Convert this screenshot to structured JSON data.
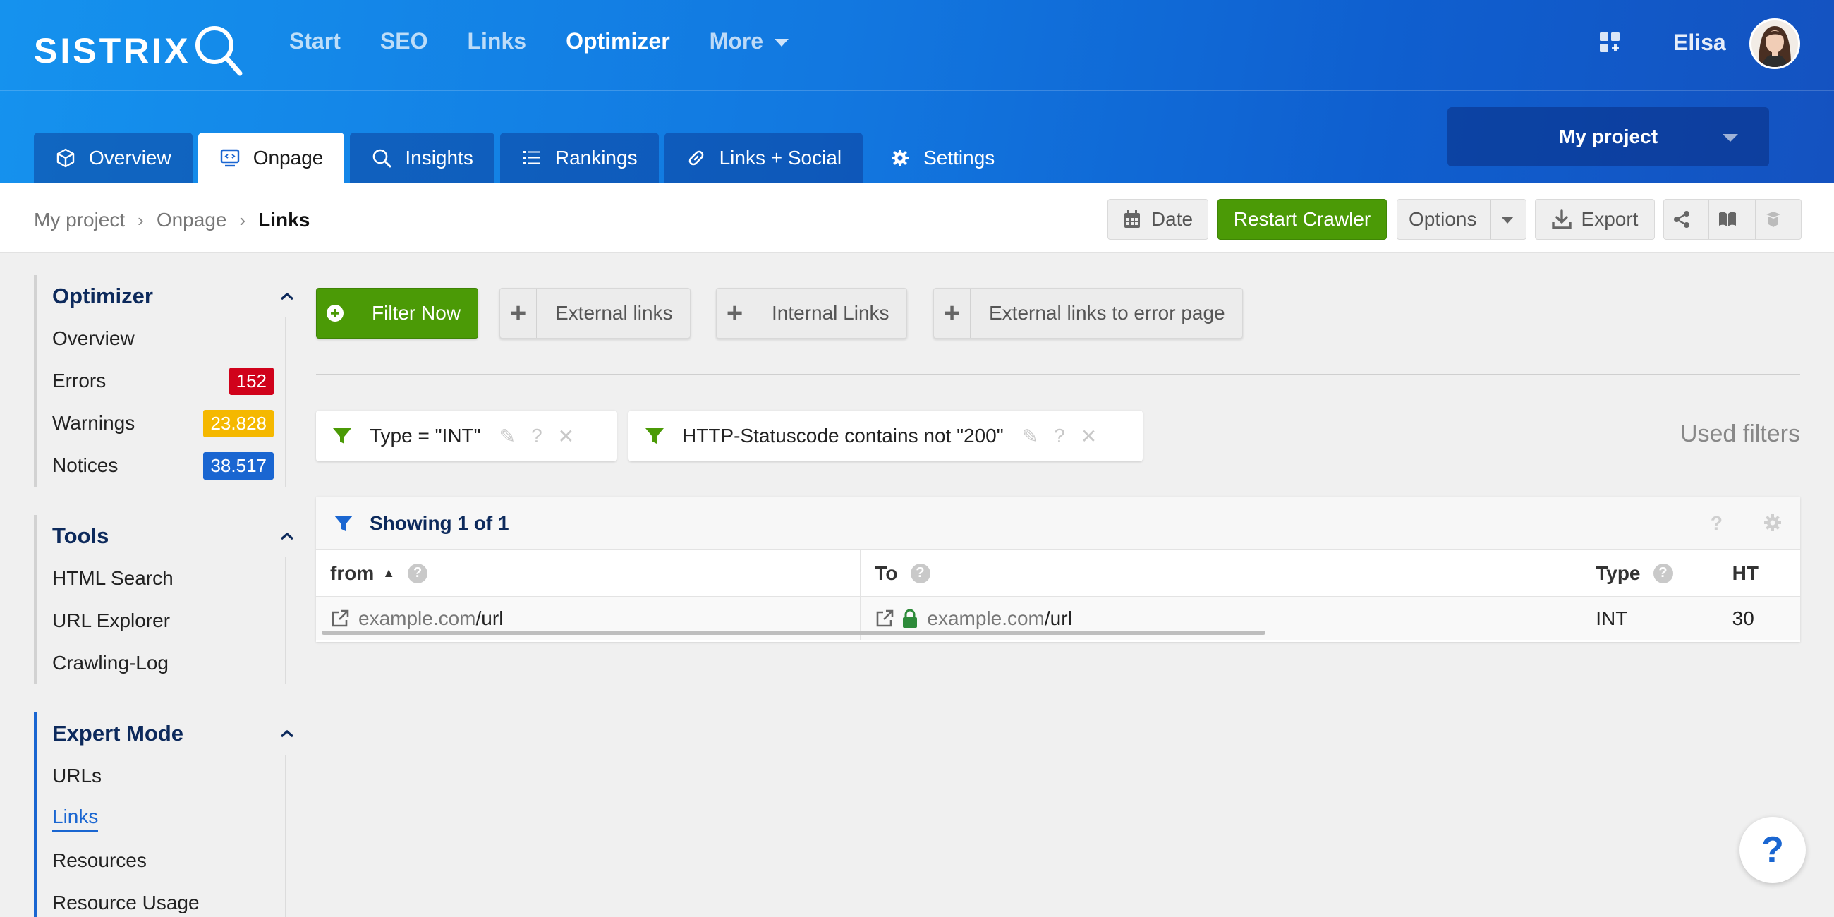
{
  "brand": {
    "logo_text": "SISTRIX"
  },
  "topnav": {
    "items": [
      {
        "label": "Start"
      },
      {
        "label": "SEO"
      },
      {
        "label": "Links"
      },
      {
        "label": "Optimizer"
      },
      {
        "label": "More"
      }
    ]
  },
  "user": {
    "name": "Elisa"
  },
  "tabs": [
    {
      "label": "Overview",
      "icon": "cube-icon"
    },
    {
      "label": "Onpage",
      "icon": "monitor-code-icon"
    },
    {
      "label": "Insights",
      "icon": "search-icon"
    },
    {
      "label": "Rankings",
      "icon": "list-icon"
    },
    {
      "label": "Links + Social",
      "icon": "link-icon"
    },
    {
      "label": "Settings",
      "icon": "gear-icon"
    }
  ],
  "project_select": {
    "value": "My project"
  },
  "breadcrumb": [
    "My project",
    "Onpage",
    "Links"
  ],
  "toolbar": {
    "date_label": "Date",
    "restart_label": "Restart Crawler",
    "options_label": "Options",
    "export_label": "Export"
  },
  "sidebar": {
    "optimizer": {
      "title": "Optimizer",
      "items": [
        {
          "label": "Overview"
        },
        {
          "label": "Errors",
          "badge": "152",
          "badge_color": "#d0021b"
        },
        {
          "label": "Warnings",
          "badge": "23.828",
          "badge_color": "#f5b800"
        },
        {
          "label": "Notices",
          "badge": "38.517",
          "badge_color": "#1a66d1"
        }
      ]
    },
    "tools": {
      "title": "Tools",
      "items": [
        {
          "label": "HTML Search"
        },
        {
          "label": "URL Explorer"
        },
        {
          "label": "Crawling-Log"
        }
      ]
    },
    "expert": {
      "title": "Expert Mode",
      "items": [
        {
          "label": "URLs"
        },
        {
          "label": "Links"
        },
        {
          "label": "Resources"
        },
        {
          "label": "Resource Usage"
        }
      ]
    }
  },
  "filter_buttons": {
    "filter_now": "Filter Now",
    "external": "External links",
    "internal": "Internal Links",
    "external_error": "External links to error page"
  },
  "active_filters": [
    {
      "label": "Type = \"INT\""
    },
    {
      "label": "HTTP-Statuscode contains not \"200\""
    }
  ],
  "used_filters_label": "Used filters",
  "table": {
    "showing": "Showing 1 of 1",
    "columns": [
      "from",
      "To",
      "Type",
      "HT"
    ],
    "rows": [
      {
        "from_domain": "example.com",
        "from_path": "/url",
        "to_domain": "example.com",
        "to_path": "/url",
        "type": "INT",
        "ht": "30"
      }
    ]
  },
  "help_label": "?",
  "colors": {
    "accent": "#1a66d1",
    "green": "#4b9a06",
    "error": "#d0021b",
    "warning": "#f5b800",
    "notice": "#1a66d1"
  }
}
